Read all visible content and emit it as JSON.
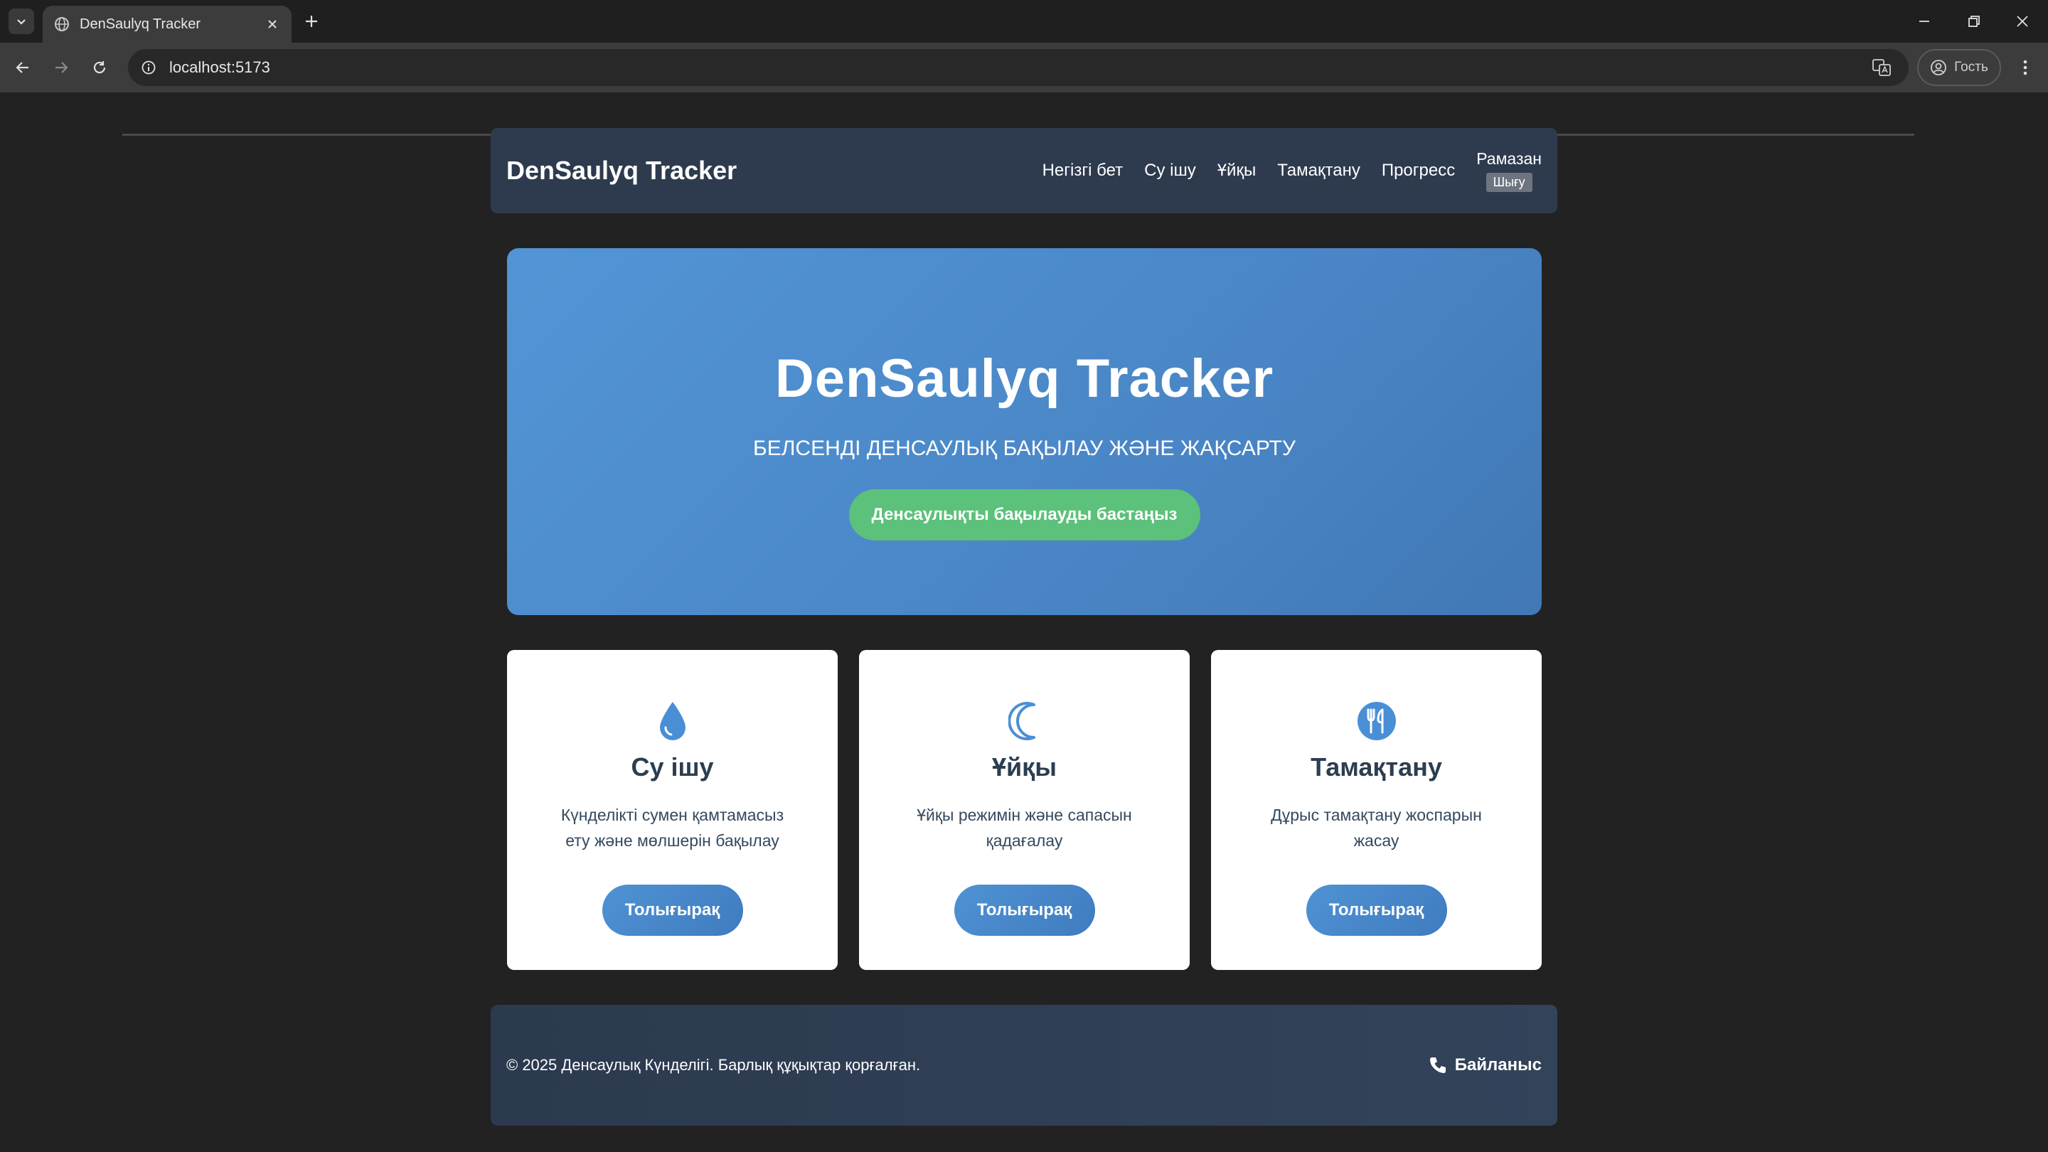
{
  "browser": {
    "tab_title": "DenSaulyq Tracker",
    "url": "localhost:5173",
    "profile_label": "Гость"
  },
  "navbar": {
    "brand": "DenSaulyq Tracker",
    "links": [
      "Негізгі бет",
      "Су ішу",
      "Ұйқы",
      "Тамақтану",
      "Прогресс"
    ],
    "user_name": "Рамазан",
    "logout_label": "Шығу"
  },
  "hero": {
    "title": "DenSaulyq Tracker",
    "subtitle": "БЕЛСЕНДІ ДЕНСАУЛЫҚ БАҚЫЛАУ ЖӘНЕ ЖАҚСАРТУ",
    "button_label": "Денсаулықты бақылауды бастаңыз",
    "colors": {
      "background": "#4a86c6",
      "button": "#5cc17a"
    }
  },
  "cards": [
    {
      "icon": "water-drop-icon",
      "title": "Су ішу",
      "description": "Күнделікті сумен қамтамасыз ету және мөлшерін бақылау",
      "button_label": "Толығырақ"
    },
    {
      "icon": "moon-icon",
      "title": "Ұйқы",
      "description": "Ұйқы режимін және сапасын қадағалау",
      "button_label": "Толығырақ"
    },
    {
      "icon": "utensils-icon",
      "title": "Тамақтану",
      "description": "Дұрыс тамақтану жоспарын жасау",
      "button_label": "Толығырақ"
    }
  ],
  "footer": {
    "copyright": "© 2025 Денсаулық Күнделігі. Барлық құқықтар қорғалған.",
    "contact_label": "Байланыс"
  }
}
